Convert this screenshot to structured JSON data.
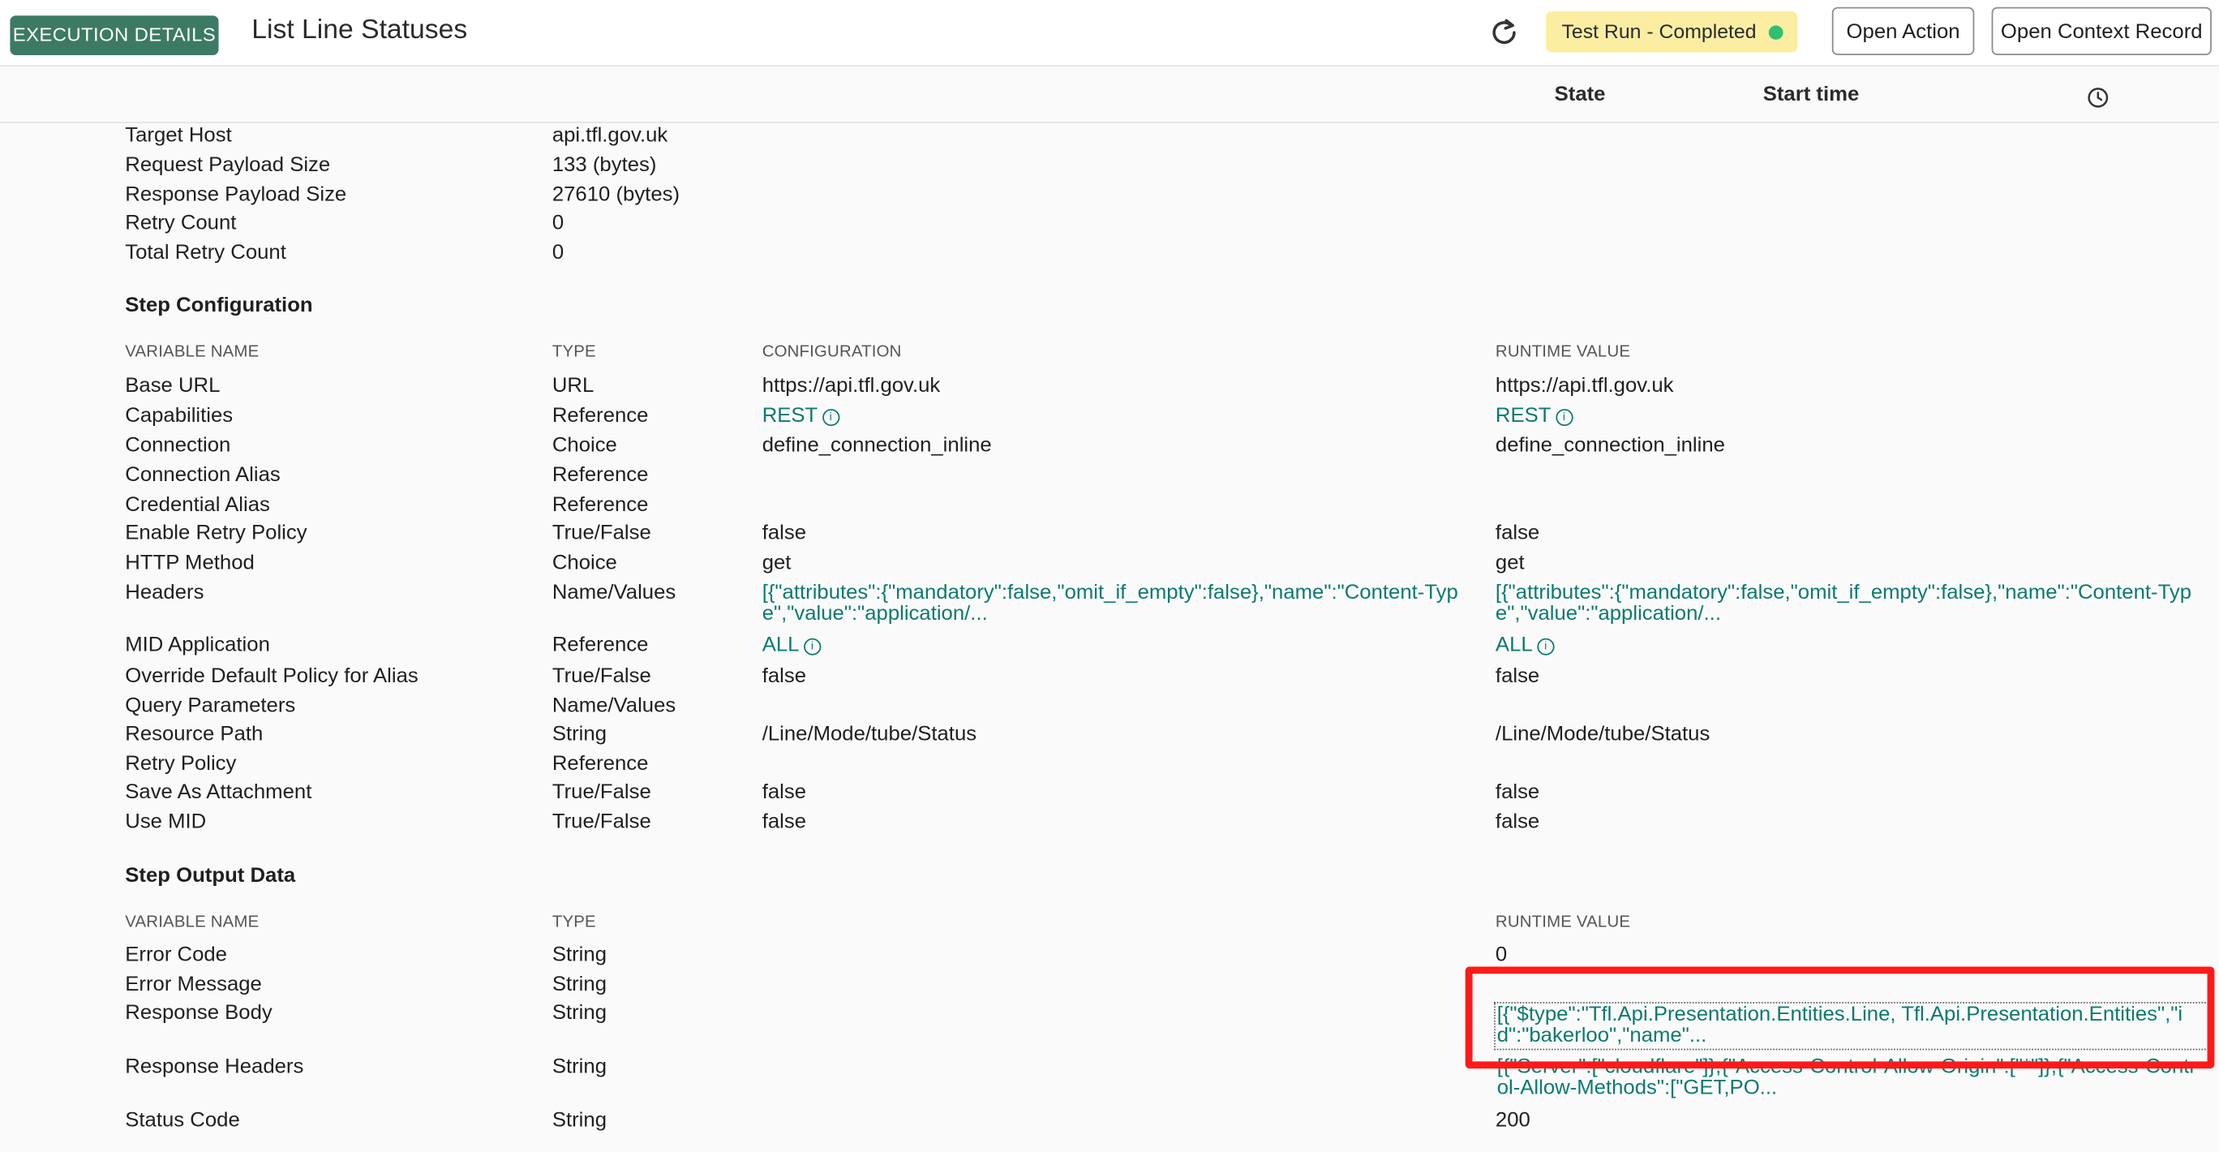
{
  "header": {
    "badge": "EXECUTION DETAILS",
    "title": "List Line Statuses",
    "status": "Test Run - Completed",
    "status_dot_color": "#2fbf71",
    "open_action": "Open Action",
    "open_context": "Open Context Record",
    "refresh_icon": "refresh-icon"
  },
  "columns": {
    "state": "State",
    "start_time": "Start time",
    "clock_icon": "clock-icon"
  },
  "summary": [
    {
      "label": "Target Host",
      "value": "api.tfl.gov.uk"
    },
    {
      "label": "Request Payload Size",
      "value": "133 (bytes)"
    },
    {
      "label": "Response Payload Size",
      "value": "27610 (bytes)"
    },
    {
      "label": "Retry Count",
      "value": "0"
    },
    {
      "label": "Total Retry Count",
      "value": "0"
    }
  ],
  "step_config": {
    "title": "Step Configuration",
    "headers": {
      "name": "VARIABLE NAME",
      "type": "TYPE",
      "config": "CONFIGURATION",
      "runtime": "RUNTIME VALUE"
    },
    "rows": [
      {
        "name": "Base URL",
        "type": "URL",
        "config": "https://api.tfl.gov.uk",
        "runtime": "https://api.tfl.gov.uk"
      },
      {
        "name": "Capabilities",
        "type": "Reference",
        "config": "REST",
        "runtime": "REST"
      },
      {
        "name": "Connection",
        "type": "Choice",
        "config": "define_connection_inline",
        "runtime": "define_connection_inline"
      },
      {
        "name": "Connection Alias",
        "type": "Reference",
        "config": "",
        "runtime": ""
      },
      {
        "name": "Credential Alias",
        "type": "Reference",
        "config": "",
        "runtime": ""
      },
      {
        "name": "Enable Retry Policy",
        "type": "True/False",
        "config": "false",
        "runtime": "false"
      },
      {
        "name": "HTTP Method",
        "type": "Choice",
        "config": "get",
        "runtime": "get"
      },
      {
        "name": "Headers",
        "type": "Name/Values",
        "config": "[{\"attributes\":{\"mandatory\":false,\"omit_if_empty\":false},\"name\":\"Content-Type\",\"value\":\"application/...",
        "runtime": "[{\"attributes\":{\"mandatory\":false,\"omit_if_empty\":false},\"name\":\"Content-Type\",\"value\":\"application/..."
      },
      {
        "name": "MID Application",
        "type": "Reference",
        "config": "ALL",
        "runtime": "ALL"
      },
      {
        "name": "Override Default Policy for Alias",
        "type": "True/False",
        "config": "false",
        "runtime": "false"
      },
      {
        "name": "Query Parameters",
        "type": "Name/Values",
        "config": "",
        "runtime": ""
      },
      {
        "name": "Resource Path",
        "type": "String",
        "config": "/Line/Mode/tube/Status",
        "runtime": "/Line/Mode/tube/Status"
      },
      {
        "name": "Retry Policy",
        "type": "Reference",
        "config": "",
        "runtime": ""
      },
      {
        "name": "Save As Attachment",
        "type": "True/False",
        "config": "false",
        "runtime": "false"
      },
      {
        "name": "Use MID",
        "type": "True/False",
        "config": "false",
        "runtime": "false"
      }
    ]
  },
  "step_output": {
    "title": "Step Output Data",
    "headers": {
      "name": "VARIABLE NAME",
      "type": "TYPE",
      "runtime": "RUNTIME VALUE"
    },
    "rows": [
      {
        "name": "Error Code",
        "type": "String",
        "runtime": "0"
      },
      {
        "name": "Error Message",
        "type": "String",
        "runtime": ""
      },
      {
        "name": "Response Body",
        "type": "String",
        "runtime": "[{\"$type\":\"Tfl.Api.Presentation.Entities.Line, Tfl.Api.Presentation.Entities\",\"id\":\"bakerloo\",\"name\"..."
      },
      {
        "name": "Response Headers",
        "type": "String",
        "runtime": "[{\"Server\":[\"cloudflare\"]},{\"Access-Control-Allow-Origin\":[\"*\"]},{\"Access-Control-Allow-Methods\":[\"GET,PO..."
      },
      {
        "name": "Status Code",
        "type": "String",
        "runtime": "200"
      }
    ]
  }
}
